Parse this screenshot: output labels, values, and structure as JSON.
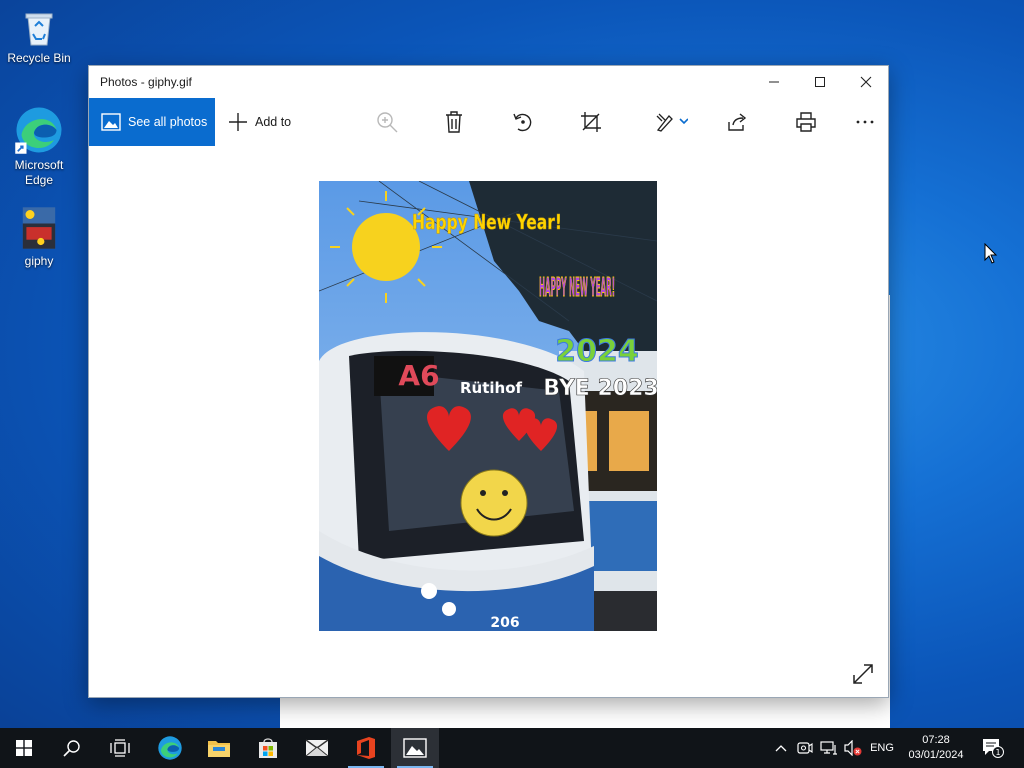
{
  "desktop": {
    "icons": [
      {
        "label": "Recycle Bin"
      },
      {
        "label": "Microsoft Edge"
      },
      {
        "label": "giphy"
      }
    ]
  },
  "window": {
    "title": "Photos - giphy.gif",
    "controls": {
      "minimize": "minimize-icon",
      "maximize": "maximize-icon",
      "close": "close-icon"
    }
  },
  "toolbar": {
    "see_all_label": "See all photos",
    "add_to_label": "Add to",
    "icons": [
      "zoom-in-icon",
      "delete-icon",
      "rotate-icon",
      "crop-icon",
      "edit-icon",
      "share-icon",
      "print-icon",
      "more-icon"
    ]
  },
  "photo": {
    "texts": {
      "happy_new_year_small": "Happy New Year!",
      "happy_new_year_big": "HAPPY NEW YEAR!",
      "year": "2024",
      "bye": "BYE 2023",
      "route": "A6",
      "destination": "Rütihof",
      "bus_number": "206"
    }
  },
  "taskbar": {
    "language": "ENG",
    "time": "07:28",
    "date": "03/01/2024",
    "notification_count": "1"
  },
  "colors": {
    "accent": "#0a6ccf",
    "taskbar": "#101418"
  }
}
